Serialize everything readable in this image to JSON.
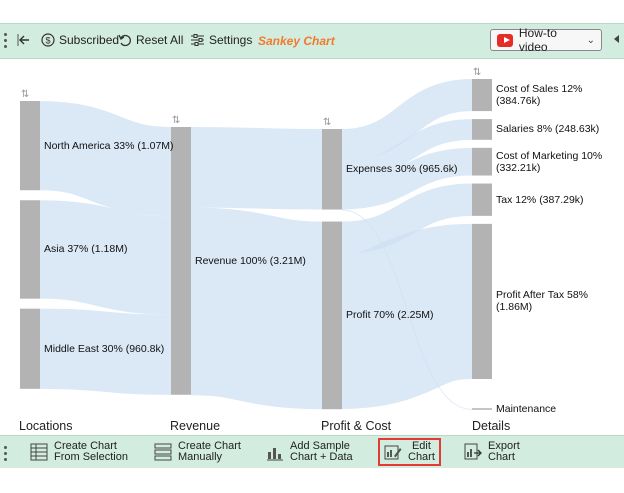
{
  "toolbar": {
    "subscribed_label": "Subscribed",
    "reset_label": "Reset All",
    "settings_label": "Settings",
    "title": "Sankey Chart",
    "howto_label": "How-to video",
    "accent_color": "#f07b2c",
    "youtube_color": "#e52d27",
    "icons": [
      "back-arrow-icon",
      "dollar-circle-icon",
      "reset-icon",
      "settings-sliders-icon",
      "youtube-icon",
      "chevron-down-icon"
    ]
  },
  "bottombar": {
    "create_selection": [
      "Create Chart",
      "From Selection"
    ],
    "create_manual": [
      "Create Chart",
      "Manually"
    ],
    "add_sample": [
      "Add Sample",
      "Chart + Data"
    ],
    "edit": [
      "Edit",
      "Chart"
    ],
    "export": [
      "Export",
      "Chart"
    ],
    "icons": [
      "table-icon",
      "list-icon",
      "chart-data-icon",
      "edit-chart-icon",
      "export-icon"
    ]
  },
  "chart_data": {
    "type": "sankey",
    "columns": [
      "Locations",
      "Revenue",
      "Profit & Cost",
      "Details"
    ],
    "nodes": [
      {
        "id": "na",
        "label": "North America 33% (1.07M)",
        "column": 0,
        "value": 1.07
      },
      {
        "id": "asia",
        "label": "Asia 37% (1.18M)",
        "column": 0,
        "value": 1.18
      },
      {
        "id": "me",
        "label": "Middle East 30% (960.8k)",
        "column": 0,
        "value": 0.9608
      },
      {
        "id": "rev",
        "label": "Revenue 100% (3.21M)",
        "column": 1,
        "value": 3.21
      },
      {
        "id": "exp",
        "label": "Expenses 30% (965.6k)",
        "column": 2,
        "value": 0.9656
      },
      {
        "id": "profit",
        "label": "Profit 70% (2.25M)",
        "column": 2,
        "value": 2.25
      },
      {
        "id": "cos",
        "label": "Cost of Sales 12% (384.76k)",
        "column": 3,
        "value": 0.38476
      },
      {
        "id": "sal",
        "label": "Salaries 8% (248.63k)",
        "column": 3,
        "value": 0.24863
      },
      {
        "id": "com",
        "label": "Cost of Marketing 10% (332.21k)",
        "column": 3,
        "value": 0.33221
      },
      {
        "id": "tax",
        "label": "Tax 12% (387.29k)",
        "column": 3,
        "value": 0.38729
      },
      {
        "id": "pat",
        "label": "Profit After Tax 58% (1.86M)",
        "column": 3,
        "value": 1.86
      },
      {
        "id": "mnt",
        "label": "Maintenance",
        "column": 3,
        "value": 0
      }
    ],
    "links": [
      {
        "source": "na",
        "target": "rev",
        "value": 1.07
      },
      {
        "source": "asia",
        "target": "rev",
        "value": 1.18
      },
      {
        "source": "me",
        "target": "rev",
        "value": 0.9608
      },
      {
        "source": "rev",
        "target": "exp",
        "value": 0.9656
      },
      {
        "source": "rev",
        "target": "profit",
        "value": 2.25
      },
      {
        "source": "exp",
        "target": "cos",
        "value": 0.38476
      },
      {
        "source": "exp",
        "target": "sal",
        "value": 0.24863
      },
      {
        "source": "exp",
        "target": "com",
        "value": 0.33221
      },
      {
        "source": "profit",
        "target": "tax",
        "value": 0.38729
      },
      {
        "source": "profit",
        "target": "pat",
        "value": 1.86
      },
      {
        "source": "exp",
        "target": "mnt",
        "value": 0
      }
    ],
    "colors": {
      "node": "#b3b3b3",
      "link": "#cfe0f3"
    }
  }
}
